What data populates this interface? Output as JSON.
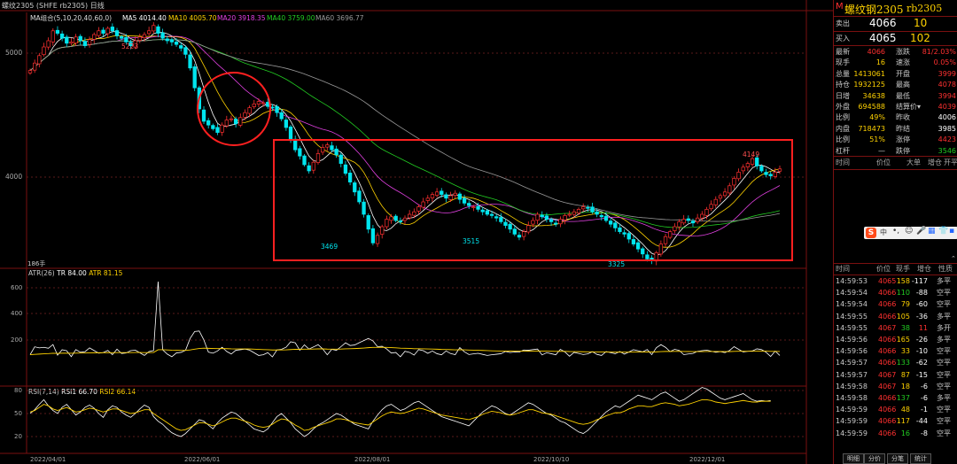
{
  "header": {
    "symbol_name": "螺纹2305",
    "symbol_code": "(SHFE rb2305)",
    "period": "日线",
    "ma_title": "MA组合(5,10,20,40,60,0)",
    "ma_values": [
      {
        "label": "MA5 4014.40",
        "color": "#ffffff"
      },
      {
        "label": "MA10 4005.70",
        "color": "#ffd200"
      },
      {
        "label": "MA20 3918.35",
        "color": "#e040e0"
      },
      {
        "label": "MA40 3759.00",
        "color": "#22cc22"
      },
      {
        "label": "MA60 3696.77",
        "color": "#999999"
      }
    ]
  },
  "price_axis": {
    "labels": [
      "5000",
      "4000"
    ]
  },
  "price_annotations": [
    "5223",
    "3469",
    "3515",
    "3325",
    "4149"
  ],
  "volume_label": "186手",
  "atr": {
    "title": "ATR(26)",
    "tr": "TR 84.00",
    "atr": "ATR 81.15",
    "axis": [
      "600",
      "400",
      "200"
    ]
  },
  "rsi": {
    "title": "RSI(7,14)",
    "rsi1": "RSI1 66.70",
    "rsi2": "RSI2 66.14",
    "axis": [
      "80",
      "50",
      "20"
    ]
  },
  "date_axis": [
    "2022/04/01",
    "2022/06/01",
    "2022/08/01",
    "2022/10/10",
    "2022/12/01"
  ],
  "colors": {
    "up": "#ff3030",
    "down": "#00e5ee",
    "annotation": "#ff2020",
    "panel_border": "#7a1010"
  },
  "chart_data": {
    "type": "candlestick",
    "title": "",
    "ylim": [
      3300,
      5300
    ],
    "close": [
      4860,
      4920,
      4980,
      5050,
      5100,
      5180,
      5160,
      5120,
      5080,
      5090,
      5130,
      5100,
      5060,
      5110,
      5150,
      5180,
      5160,
      5200,
      5180,
      5140,
      5120,
      5090,
      5060,
      5100,
      5130,
      5150,
      5180,
      5223,
      5160,
      5120,
      5100,
      5090,
      5070,
      5040,
      4990,
      4880,
      4720,
      4550,
      4450,
      4420,
      4390,
      4360,
      4420,
      4460,
      4470,
      4430,
      4480,
      4520,
      4560,
      4590,
      4610,
      4600,
      4570,
      4560,
      4520,
      4470,
      4400,
      4310,
      4220,
      4170,
      4100,
      4050,
      4120,
      4190,
      4240,
      4260,
      4220,
      4180,
      4110,
      4030,
      3960,
      3880,
      3800,
      3700,
      3580,
      3469,
      3530,
      3600,
      3660,
      3680,
      3650,
      3640,
      3670,
      3700,
      3720,
      3760,
      3800,
      3830,
      3860,
      3880,
      3860,
      3830,
      3850,
      3870,
      3820,
      3790,
      3770,
      3760,
      3740,
      3720,
      3700,
      3690,
      3670,
      3640,
      3610,
      3580,
      3540,
      3515,
      3560,
      3610,
      3650,
      3700,
      3680,
      3660,
      3640,
      3620,
      3660,
      3690,
      3700,
      3720,
      3740,
      3760,
      3750,
      3720,
      3700,
      3680,
      3650,
      3620,
      3590,
      3560,
      3540,
      3500,
      3460,
      3420,
      3380,
      3340,
      3325,
      3390,
      3460,
      3520,
      3560,
      3600,
      3640,
      3660,
      3650,
      3630,
      3670,
      3700,
      3740,
      3780,
      3820,
      3850,
      3880,
      3930,
      3990,
      4040,
      4080,
      4110,
      4149,
      4090,
      4050,
      4020,
      4010,
      4040,
      4066
    ],
    "rsi1": [
      50,
      55,
      62,
      68,
      60,
      54,
      50,
      58,
      62,
      55,
      48,
      52,
      58,
      61,
      57,
      50,
      45,
      55,
      60,
      58,
      52,
      48,
      45,
      50,
      56,
      61,
      58,
      46,
      40,
      36,
      30,
      25,
      22,
      20,
      24,
      30,
      36,
      42,
      40,
      35,
      30,
      38,
      44,
      48,
      52,
      50,
      45,
      40,
      35,
      30,
      28,
      26,
      30,
      38,
      46,
      50,
      44,
      38,
      30,
      25,
      20,
      24,
      30,
      35,
      38,
      42,
      46,
      50,
      48,
      44,
      40,
      36,
      34,
      32,
      30,
      40,
      48,
      55,
      60,
      62,
      58,
      54,
      56,
      60,
      64,
      66,
      62,
      58,
      54,
      50,
      46,
      44,
      42,
      40,
      38,
      36,
      34,
      40,
      46,
      52,
      56,
      60,
      58,
      54,
      50,
      48,
      52,
      56,
      60,
      64,
      62,
      58,
      54,
      50,
      48,
      44,
      40,
      38,
      34,
      30,
      26,
      24,
      28,
      34,
      40,
      46,
      52,
      56,
      60,
      58,
      62,
      66,
      70,
      74,
      72,
      70,
      68,
      72,
      76,
      78,
      74,
      70,
      66,
      68,
      72,
      76,
      80,
      84,
      82,
      78,
      74,
      70,
      68,
      70,
      72,
      74,
      76,
      72,
      68,
      66,
      67,
      66,
      67
    ],
    "rsi2": [
      52,
      54,
      58,
      62,
      60,
      56,
      54,
      56,
      58,
      55,
      52,
      53,
      55,
      57,
      56,
      54,
      52,
      54,
      56,
      56,
      54,
      52,
      50,
      51,
      53,
      55,
      55,
      50,
      46,
      42,
      38,
      34,
      30,
      28,
      29,
      32,
      35,
      38,
      38,
      36,
      34,
      36,
      39,
      42,
      44,
      44,
      42,
      40,
      38,
      35,
      33,
      32,
      33,
      36,
      40,
      43,
      42,
      39,
      35,
      32,
      28,
      29,
      32,
      34,
      36,
      38,
      40,
      43,
      43,
      42,
      40,
      38,
      37,
      36,
      35,
      39,
      43,
      47,
      50,
      52,
      51,
      50,
      51,
      53,
      55,
      57,
      56,
      54,
      52,
      50,
      48,
      47,
      46,
      45,
      44,
      43,
      42,
      44,
      46,
      49,
      51,
      53,
      52,
      51,
      49,
      48,
      49,
      51,
      53,
      55,
      55,
      53,
      51,
      50,
      49,
      47,
      45,
      43,
      41,
      39,
      37,
      36,
      37,
      39,
      42,
      44,
      47,
      49,
      51,
      51,
      53,
      56,
      58,
      60,
      60,
      59,
      59,
      61,
      63,
      64,
      63,
      62,
      60,
      61,
      62,
      64,
      66,
      68,
      68,
      67,
      65,
      64,
      63,
      64,
      65,
      66,
      67,
      66,
      65,
      65,
      66,
      66,
      66
    ]
  }
}
